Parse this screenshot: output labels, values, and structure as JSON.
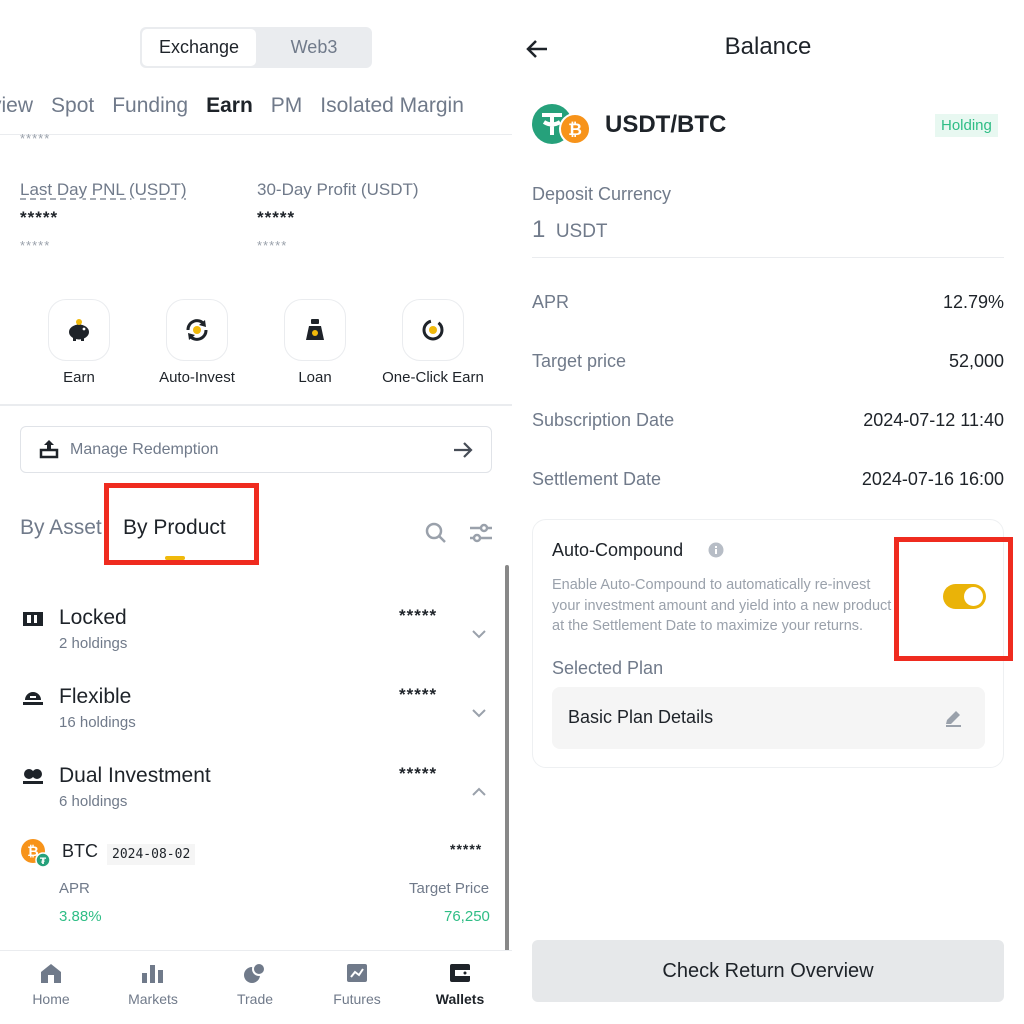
{
  "left": {
    "segment": {
      "active": "Exchange",
      "inactive": "Web3"
    },
    "tabs": [
      "rview",
      "Spot",
      "Funding",
      "Earn",
      "PM",
      "Isolated Margin"
    ],
    "active_tab": "Earn",
    "top_masked": "*****",
    "stats": [
      {
        "label": "Last Day PNL (USDT)",
        "value": "*****",
        "sub": "*****"
      },
      {
        "label": "30-Day Profit (USDT)",
        "value": "*****",
        "sub": "*****"
      }
    ],
    "quick_actions": [
      {
        "label": "Earn",
        "icon": "piggy-bank-icon"
      },
      {
        "label": "Auto-Invest",
        "icon": "auto-invest-icon"
      },
      {
        "label": "Loan",
        "icon": "money-bag-icon"
      },
      {
        "label": "One-Click Earn",
        "icon": "one-click-earn-icon"
      }
    ],
    "manage_redemption": "Manage Redemption",
    "view_tabs": {
      "by_asset": "By Asset",
      "by_product": "By Product"
    },
    "products": [
      {
        "title": "Locked",
        "sub": "2 holdings",
        "value": "*****",
        "icon": "locked-icon"
      },
      {
        "title": "Flexible",
        "sub": "16 holdings",
        "value": "*****",
        "icon": "flexible-icon"
      },
      {
        "title": "Dual Investment",
        "sub": "6 holdings",
        "value": "*****",
        "icon": "dual-investment-icon"
      }
    ],
    "holding": {
      "coin": "BTC",
      "date": "2024-08-02",
      "value": "*****",
      "apr_label": "APR",
      "apr": "3.88%",
      "target_label": "Target Price",
      "target": "76,250"
    },
    "nav": [
      "Home",
      "Markets",
      "Trade",
      "Futures",
      "Wallets"
    ],
    "nav_active": "Wallets"
  },
  "right": {
    "title": "Balance",
    "pair": "USDT/BTC",
    "badge": "Holding",
    "deposit_label": "Deposit Currency",
    "deposit_amount": "1",
    "deposit_unit": "USDT",
    "details": [
      {
        "label": "APR",
        "value": "12.79%"
      },
      {
        "label": "Target price",
        "value": "52,000"
      },
      {
        "label": "Subscription Date",
        "value": "2024-07-12 11:40"
      },
      {
        "label": "Settlement Date",
        "value": "2024-07-16 16:00"
      }
    ],
    "auto_compound": {
      "title": "Auto-Compound",
      "desc_lines": [
        "Enable Auto-Compound to automatically re-invest",
        "your investment amount and yield into a new product",
        "at the Settlement Date to maximize your returns."
      ],
      "enabled": true,
      "selected_plan_label": "Selected Plan",
      "plan_name": "Basic Plan Details"
    },
    "cta": "Check Return Overview"
  },
  "colors": {
    "accent": "#f0b90b",
    "green": "#2ebd85",
    "highlight": "#ef2b1f",
    "toggle": "#eab308"
  }
}
